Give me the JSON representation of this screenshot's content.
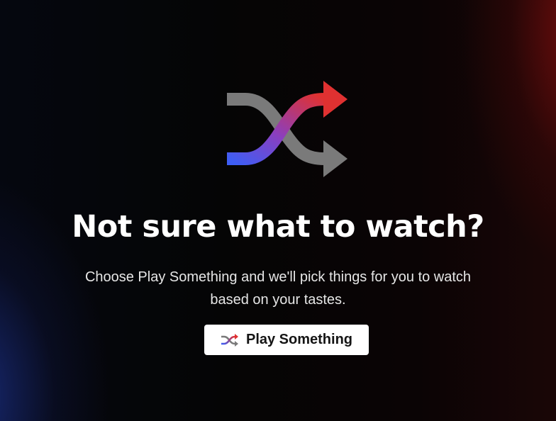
{
  "hero": {
    "icon": "shuffle-icon",
    "headline": "Not sure what to watch?",
    "description": "Choose Play Something and we'll pick things for you to watch based on your tastes."
  },
  "play_button": {
    "icon": "shuffle-icon",
    "label": "Play Something"
  },
  "colors": {
    "accent_red": "#e50914",
    "accent_blue": "#3d5ef5",
    "arrow_gray": "#7a7a7a",
    "button_bg": "#ffffff"
  }
}
